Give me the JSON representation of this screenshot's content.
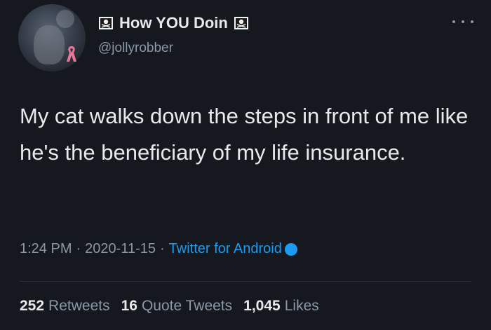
{
  "author": {
    "display_name": "How YOU Doin",
    "handle": "@jollyrobber",
    "avatar_icon": "avatar-photo",
    "badge_icons": [
      "pirate-flag-icon",
      "pirate-flag-icon"
    ],
    "ribbon_icon": "pink-ribbon-icon"
  },
  "tweet": {
    "text": "My cat walks down the steps in front of me like he's the beneficiary of my life insurance."
  },
  "meta": {
    "time": "1:24 PM",
    "separator": "·",
    "date": "2020-11-15",
    "source": "Twitter for Android"
  },
  "stats": {
    "retweets_count": "252",
    "retweets_label": "Retweets",
    "quotes_count": "16",
    "quotes_label": "Quote Tweets",
    "likes_count": "1,045",
    "likes_label": "Likes"
  },
  "colors": {
    "background": "#15181f",
    "text": "#e7e9ea",
    "muted": "#8b98a5",
    "accent": "#1d9bf0",
    "divider": "#2f3336"
  }
}
